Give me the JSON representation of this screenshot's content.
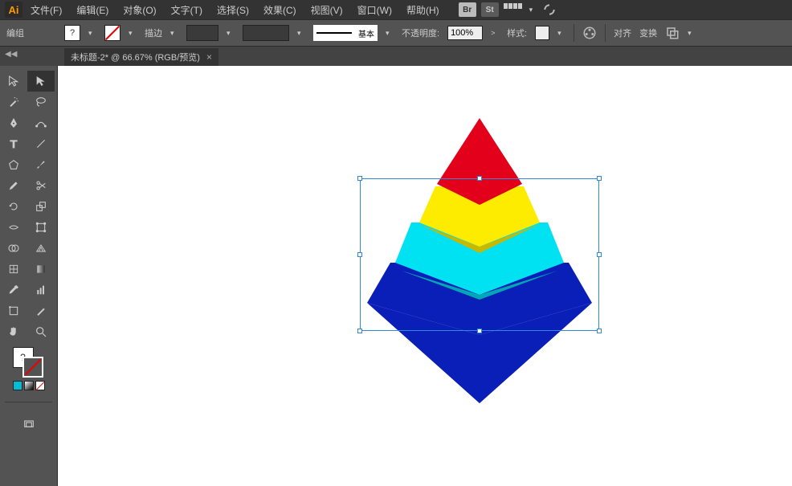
{
  "app": {
    "logo": "Ai"
  },
  "menu": {
    "items": [
      "文件(F)",
      "编辑(E)",
      "对象(O)",
      "文字(T)",
      "选择(S)",
      "效果(C)",
      "视图(V)",
      "窗口(W)",
      "帮助(H)"
    ],
    "bridge": "Br",
    "stock": "St"
  },
  "control": {
    "mode_label": "编组",
    "fill_tooltip": "?",
    "stroke_label": "描边",
    "stroke_style_label": "基本",
    "opacity_label": "不透明度:",
    "opacity_value": "100%",
    "style_label": "样式:",
    "align_label": "对齐",
    "transform_label": "变换"
  },
  "tab": {
    "title": "未标题-2* @ 66.67% (RGB/预览)",
    "close": "×"
  },
  "tools": {
    "names": [
      [
        "selection-tool",
        "direct-selection-tool"
      ],
      [
        "magic-wand-tool",
        "lasso-tool"
      ],
      [
        "pen-tool",
        "curvature-tool"
      ],
      [
        "type-tool",
        "line-tool"
      ],
      [
        "shape-tool",
        "brush-tool"
      ],
      [
        "pencil-tool",
        "eraser-tool"
      ],
      [
        "rotate-tool",
        "scale-tool"
      ],
      [
        "width-tool",
        "free-transform-tool"
      ],
      [
        "shape-builder-tool",
        "perspective-tool"
      ],
      [
        "mesh-tool",
        "gradient-tool"
      ],
      [
        "eyedropper-tool",
        "blend-tool"
      ],
      [
        "symbol-spray-tool",
        "graph-tool"
      ],
      [
        "artboard-tool",
        "slice-tool"
      ],
      [
        "hand-tool",
        "zoom-tool"
      ]
    ]
  },
  "artwork": {
    "colors": {
      "red": "#e2001a",
      "yellow": "#fdeb00",
      "cyan": "#00e1f2",
      "blue": "#0a1fb8",
      "blue_side": "#091a9e"
    }
  }
}
